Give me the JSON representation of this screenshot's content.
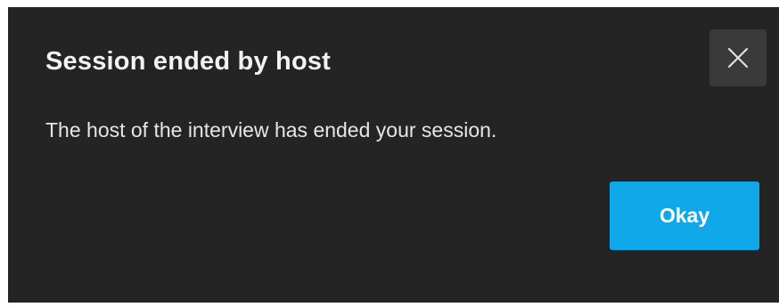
{
  "dialog": {
    "title": "Session ended by host",
    "message": "The host of the interview has ended your session.",
    "close_icon": "close-icon",
    "okay_label": "Okay"
  },
  "colors": {
    "dialog_background": "#242424",
    "close_button_background": "#3a3a3a",
    "primary_button": "#11a8ea",
    "text_primary": "#f2f2f2"
  }
}
